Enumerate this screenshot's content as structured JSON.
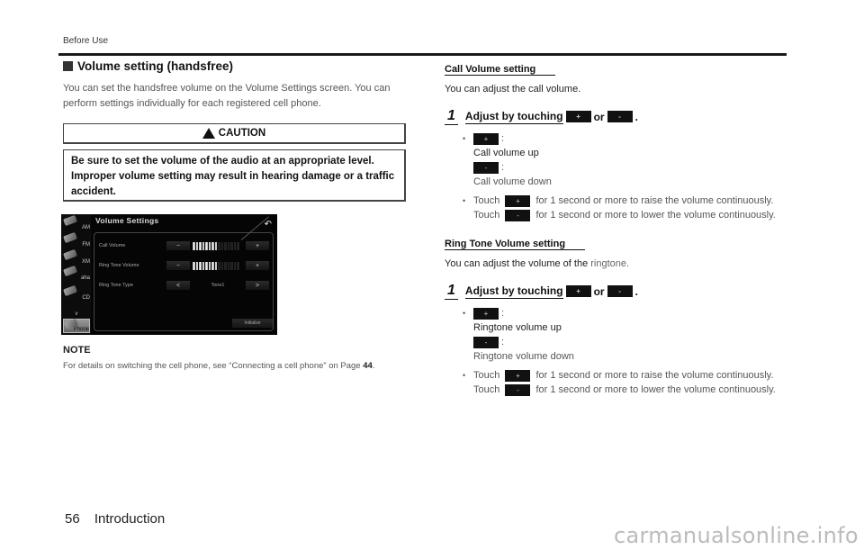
{
  "running_head": "Before Use",
  "section": {
    "title": "Volume setting (handsfree)",
    "intro": "You can set the handsfree volume on the Volume Settings screen. You can perform settings individually for each registered cell phone."
  },
  "caution": {
    "label": "CAUTION",
    "icon": "warning-triangle-icon",
    "text": "Be sure to set the volume of the audio at an appropriate level. Improper volume setting may result in hearing damage or a traffic accident."
  },
  "screen": {
    "title": "Volume Settings",
    "back_icon": "return-arrow-icon",
    "sidebar": [
      {
        "label": "AM"
      },
      {
        "label": "FM"
      },
      {
        "label": "XM"
      },
      {
        "label": "aha"
      },
      {
        "label": "CD"
      },
      {
        "label": "v"
      },
      {
        "label": "Phone",
        "active": true
      }
    ],
    "rows": [
      {
        "label": "Call Volume",
        "minus": "−",
        "plus": "+",
        "level": 8,
        "max": 15
      },
      {
        "label": "Ring Tone Volume",
        "minus": "−",
        "plus": "+",
        "level": 8,
        "max": 15
      },
      {
        "label": "Ring Tone Type",
        "prev": "<",
        "next": ">",
        "value": "Tone1"
      }
    ],
    "initialize": "Initialize"
  },
  "note": {
    "label": "NOTE",
    "text_before": "For details on switching the cell phone, see “Connecting a cell phone” on Page ",
    "page_ref": "44",
    "text_after": "."
  },
  "call_volume": {
    "heading": "Call Volume setting",
    "intro": "You can adjust the call volume.",
    "step_num": "1",
    "step_text": "Adjust by touching",
    "or": "or",
    "period": ".",
    "plus": "+",
    "minus": "-",
    "up_label": "Call volume up",
    "down_label": "Call volume down",
    "touch": "Touch",
    "raise_text": "for 1 second or more to raise the volume continuously.",
    "lower_text": "for 1 second or more to lower the volume continuously."
  },
  "ring_volume": {
    "heading": "Ring Tone Volume setting",
    "intro_a": "You can adjust the volume of the ",
    "intro_b": "ringtone.",
    "step_num": "1",
    "step_text": "Adjust by touching",
    "or": "or",
    "period": ".",
    "plus": "+",
    "minus": "-",
    "up_label": "Ringtone volume up",
    "down_label": "Ringtone volume down",
    "touch": "Touch",
    "raise_text": "for 1 second or more to raise the volume continuously.",
    "lower_text": "for 1 second or more to lower the volume continuously."
  },
  "footer": {
    "page": "56",
    "section": "Introduction"
  },
  "watermark": "carmanualsonline.info"
}
